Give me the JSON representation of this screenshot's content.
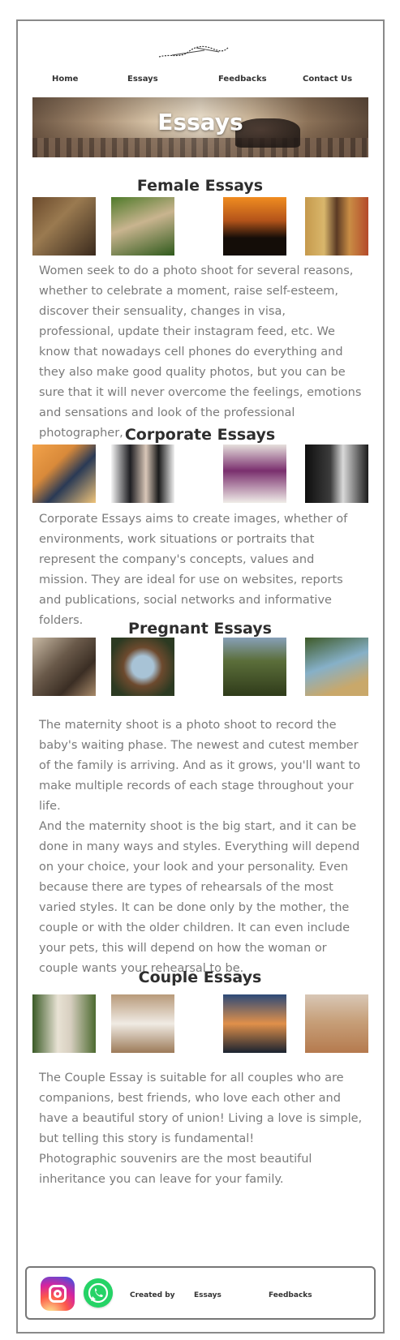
{
  "nav": {
    "items": [
      {
        "label": "Home"
      },
      {
        "label": "Essays"
      },
      {
        "label": "Feedbacks"
      },
      {
        "label": "Contact Us"
      }
    ]
  },
  "banner": {
    "title": "Essays"
  },
  "sections": [
    {
      "title": "Female Essays",
      "photos": [
        "woman-in-field-photo",
        "woman-in-hammock-photo",
        "silhouette-sunset-photo",
        "woman-at-doorway-photo"
      ],
      "text": "Women seek to do a photo shoot for several reasons, whether to celebrate a moment, raise self-esteem, discover their sensuality, changes in visa, professional, update their instagram feed, etc. We know that nowadays cell phones do everything and they also make good quality photos, but you can be sure that it will never overcome the feelings, emotions and sensations and look of the professional photographer,"
    },
    {
      "title": "Corporate Essays",
      "photos": [
        "businesswoman-portrait-photo",
        "business-couple-photo",
        "woman-with-books-photo",
        "businessman-portrait-photo"
      ],
      "text": "Corporate Essays aims to create images, whether of environments, work situations or portraits  that represent the company's concepts, values and mission. They are ideal for use on websites, reports and publications, social networks and informative folders."
    },
    {
      "title": "Pregnant Essays",
      "photos": [
        "pregnant-on-railway-photo",
        "pregnant-flower-arch-photo",
        "pregnant-couple-photo",
        "pregnant-blue-dress-photo"
      ],
      "text": "The maternity shoot is a photo shoot to record the baby's waiting phase. The newest and cutest member of the family is arriving. And as it grows, you'll want to make multiple records of each stage throughout your life.\nAnd the maternity shoot is the big start, and it can be done in many ways and styles. Everything will depend on your choice, your look and your personality. Even because there are types of rehearsals of the most varied styles. It can be done only by the mother, the couple or with the older children. It can even include your pets, this will depend on how the woman or couple wants your rehearsal to be."
    },
    {
      "title": "Couple Essays",
      "photos": [
        "couple-walking-photo",
        "couple-sitting-photo",
        "couple-sunset-lake-photo",
        "couple-dirt-road-photo"
      ],
      "text": "The Couple Essay is suitable for all couples who are companions, best friends, who love each other and have a beautiful story of union! Living a love is simple, but telling this story is fundamental!\nPhotographic souvenirs are the most beautiful inheritance you can leave for your family."
    }
  ],
  "footer": {
    "icons": [
      "instagram-icon",
      "whatsapp-icon"
    ],
    "links": [
      {
        "label": "Created by"
      },
      {
        "label": "Essays"
      },
      {
        "label": "Feedbacks"
      }
    ]
  }
}
